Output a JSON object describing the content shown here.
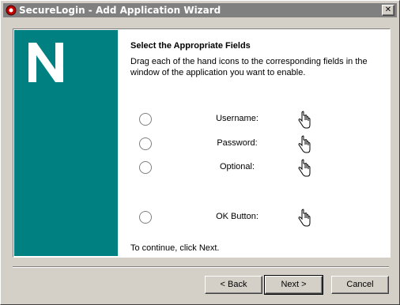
{
  "window": {
    "title": "SecureLogin - Add Application Wizard",
    "close_glyph": "✕"
  },
  "wizard": {
    "heading": "Select the Appropriate Fields",
    "description": "Drag each of the hand icons to the corresponding fields in the window of the application you want to enable.",
    "footer_text": "To continue, click Next.",
    "fields": [
      {
        "label": "Username:"
      },
      {
        "label": "Password:"
      },
      {
        "label": "Optional:"
      },
      {
        "label": "OK Button:"
      }
    ]
  },
  "buttons": {
    "back": "< Back",
    "next": "Next >",
    "cancel": "Cancel"
  },
  "colors": {
    "sidebar": "#008080",
    "titlebar": "#808080",
    "dialog": "#d4d0c8"
  },
  "icons": {
    "logo": "novell-n-logo",
    "drag": "pointing-hand-icon"
  }
}
